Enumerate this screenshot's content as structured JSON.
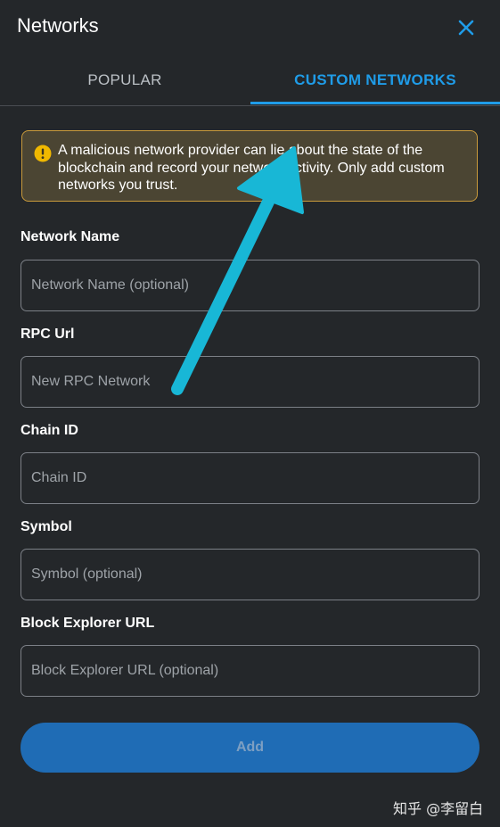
{
  "header": {
    "title": "Networks",
    "close_icon": "close-icon"
  },
  "tabs": [
    {
      "label": "POPULAR",
      "active": false
    },
    {
      "label": "CUSTOM NETWORKS",
      "active": true
    }
  ],
  "warning": {
    "icon": "warning-icon",
    "text": "A malicious network provider can lie about the state of the blockchain and record your network activity. Only add custom networks you trust."
  },
  "form": {
    "fields": [
      {
        "label": "Network Name",
        "placeholder": "Network Name (optional)",
        "value": ""
      },
      {
        "label": "RPC Url",
        "placeholder": "New RPC Network",
        "value": ""
      },
      {
        "label": "Chain ID",
        "placeholder": "Chain ID",
        "value": ""
      },
      {
        "label": "Symbol",
        "placeholder": "Symbol (optional)",
        "value": ""
      },
      {
        "label": "Block Explorer URL",
        "placeholder": "Block Explorer URL (optional)",
        "value": ""
      }
    ],
    "submit_label": "Add",
    "submit_disabled": true
  },
  "watermark": "知乎 @李留白",
  "colors": {
    "background": "#24272a",
    "accent": "#1f9ce8",
    "warning_bg": "#4b4533",
    "warning_border": "#c99a3b",
    "button_bg": "#1f6cb5",
    "annotation_arrow": "#18b7d6"
  }
}
